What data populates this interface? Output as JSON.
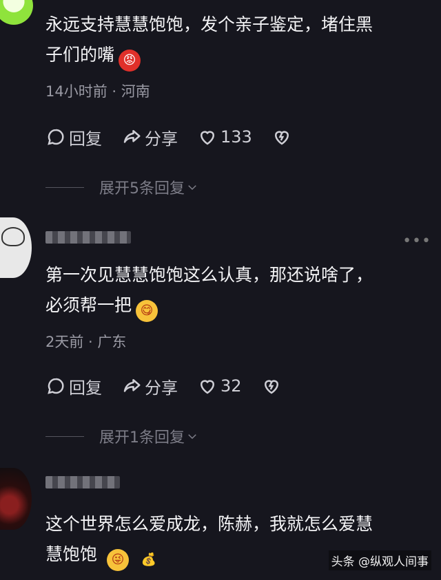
{
  "comments": [
    {
      "text_lines": [
        "永远支持慧慧饱饱，发个亲子鉴定，堵住黑",
        "子们的嘴"
      ],
      "emoji": "angry-face-emoji",
      "meta": "14小时前 · 河南",
      "reply_label": "回复",
      "share_label": "分享",
      "likes": "133",
      "expand_label": "展开5条回复"
    },
    {
      "text_lines": [
        "第一次见慧慧饱饱这么认真，那还说啥了，",
        "必须帮一把"
      ],
      "emoji": "yum-face-emoji",
      "meta": "2天前 · 广东",
      "reply_label": "回复",
      "share_label": "分享",
      "likes": "32",
      "expand_label": "展开1条回复"
    },
    {
      "text_lines": [
        "这个世界怎么爱成龙，陈赫，我就怎么爱慧",
        "慧饱饱"
      ],
      "emoji": "yum-face-emoji"
    }
  ],
  "watermark": "头条 @纵观人间事"
}
